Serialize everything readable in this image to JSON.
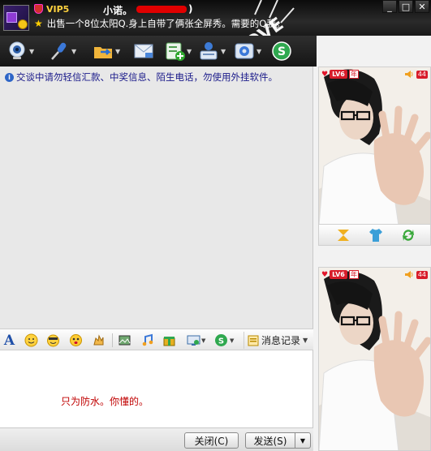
{
  "header": {
    "vip_label": "VIP5",
    "nickname": "小诺。",
    "nickname_close": ")",
    "signature": "出售一个8位太阳Q.身上自带了俩张全屏秀。需要的Q我。",
    "window_controls": [
      "minimize-icon",
      "maximize-icon",
      "close-icon"
    ]
  },
  "toolbar": {
    "buttons": [
      "video-call-icon",
      "voice-call-icon",
      "file-transfer-icon",
      "email-icon",
      "add-contact-icon",
      "info-card-icon",
      "settings-icon",
      "search-s-icon"
    ]
  },
  "chat": {
    "notice": "交谈中请勿轻信汇款、中奖信息、陌生电话，勿使用外挂软件。"
  },
  "format_bar": {
    "font_icon": "A",
    "icons": [
      "font-icon",
      "smiley-icon",
      "sticker-icon",
      "magic-emoticon-icon",
      "shake-icon",
      "screenshot-icon",
      "music-icon",
      "gift-icon",
      "screen-share-icon",
      "soso-icon"
    ],
    "history_label": "消息记录"
  },
  "input": {
    "draft_text": "只为防水。你懂的。"
  },
  "actions": {
    "close_label": "关闭(C)",
    "send_label": "发送(S)"
  },
  "right_panel": {
    "top_video": {
      "level": "LV6",
      "year_badge": "年",
      "volume": "44"
    },
    "bottom_video": {
      "level": "LV6",
      "year_badge": "年",
      "volume": "44"
    },
    "video_tools": [
      "flip-icon",
      "shirt-icon",
      "refresh-icon"
    ]
  },
  "colors": {
    "header_bg": "#1a1a1a",
    "notice_text": "#1a1a8a",
    "draft_text": "#c00000",
    "badge_red": "#d81c2a"
  }
}
